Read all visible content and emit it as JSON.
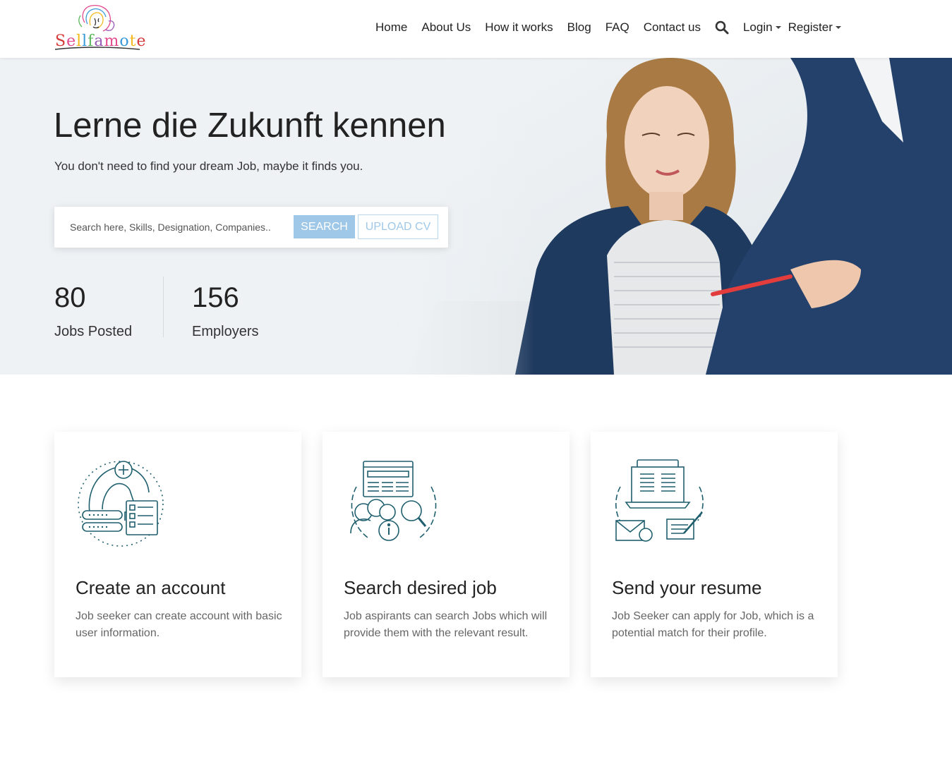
{
  "brand": {
    "logo_text": "Sellfamote"
  },
  "nav": {
    "items": [
      "Home",
      "About Us",
      "How it works",
      "Blog",
      "FAQ",
      "Contact us"
    ],
    "login": "Login",
    "register": "Register"
  },
  "hero": {
    "title": "Lerne die Zukunft kennen",
    "subtitle": "You don't need to find your dream Job, maybe it finds you.",
    "search_placeholder": "Search here, Skills, Designation, Companies..",
    "search_button": "SEARCH",
    "upload_button": "UPLOAD CV",
    "stats": [
      {
        "value": "80",
        "label": "Jobs Posted"
      },
      {
        "value": "156",
        "label": "Employers"
      }
    ]
  },
  "steps": [
    {
      "title": "Create an account",
      "text": "Job seeker can create account with basic user information.",
      "icon": "create-account-icon"
    },
    {
      "title": "Search desired job",
      "text": "Job aspirants can search Jobs which will provide them with the relevant result.",
      "icon": "search-job-icon"
    },
    {
      "title": "Send your resume",
      "text": "Job Seeker can apply for Job, which is a potential match for their profile.",
      "icon": "send-resume-icon"
    }
  ],
  "colors": {
    "accent": "#9fc8e8",
    "icon_stroke": "#1f5f6e",
    "hero_bg": "#eef2f5"
  }
}
